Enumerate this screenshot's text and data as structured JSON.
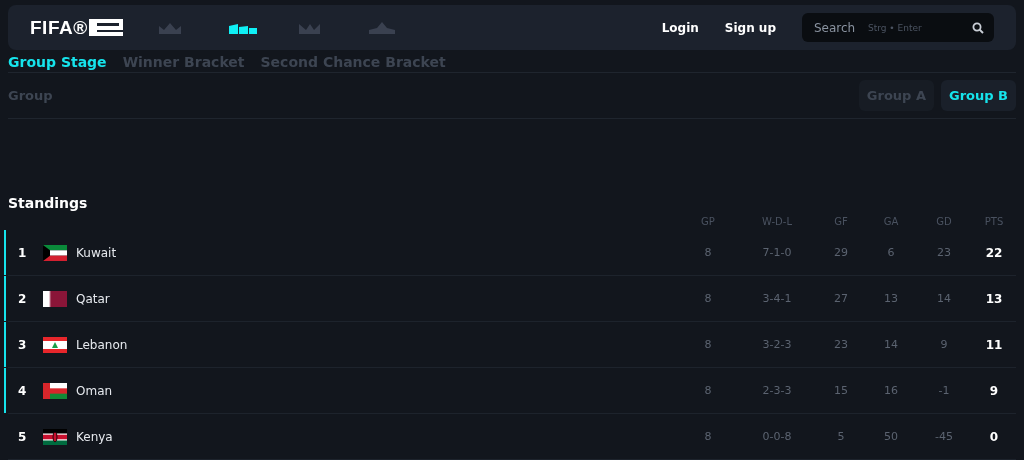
{
  "header": {
    "logo": "FIFA®",
    "nav_icons": [
      {
        "kind": "crown",
        "selected": false
      },
      {
        "kind": "steps",
        "selected": true
      },
      {
        "kind": "peaks",
        "selected": false
      },
      {
        "kind": "star",
        "selected": false
      }
    ],
    "links": [
      "Login",
      "Sign up"
    ],
    "search": {
      "placeholder": "Search",
      "shortcut": "Strg • Enter"
    }
  },
  "tabs": [
    {
      "label": "Group Stage",
      "selected": true
    },
    {
      "label": "Winner Bracket",
      "selected": false
    },
    {
      "label": "Second Chance Bracket",
      "selected": false
    }
  ],
  "group_filter": {
    "label": "Group",
    "options": [
      {
        "label": "Group A",
        "selected": false
      },
      {
        "label": "Group B",
        "selected": true
      }
    ]
  },
  "standings": {
    "title": "Standings",
    "columns": [
      "GP",
      "W-D-L",
      "GF",
      "GA",
      "GD",
      "PTS"
    ],
    "rows": [
      {
        "rank": "1",
        "kind": "kw",
        "team": "Kuwait",
        "qualified": true,
        "cells": [
          "8",
          "7-1-0",
          "29",
          "6",
          "23",
          "22"
        ]
      },
      {
        "rank": "2",
        "kind": "qa",
        "team": "Qatar",
        "qualified": true,
        "cells": [
          "8",
          "3-4-1",
          "27",
          "13",
          "14",
          "13"
        ]
      },
      {
        "rank": "3",
        "kind": "lb",
        "team": "Lebanon",
        "qualified": true,
        "cells": [
          "8",
          "3-2-3",
          "23",
          "14",
          "9",
          "11"
        ]
      },
      {
        "rank": "4",
        "kind": "om",
        "team": "Oman",
        "qualified": true,
        "cells": [
          "8",
          "2-3-3",
          "15",
          "16",
          "-1",
          "9"
        ]
      },
      {
        "rank": "5",
        "kind": "ke",
        "team": "Kenya",
        "qualified": false,
        "cells": [
          "8",
          "0-0-8",
          "5",
          "50",
          "-45",
          "0"
        ]
      }
    ]
  }
}
